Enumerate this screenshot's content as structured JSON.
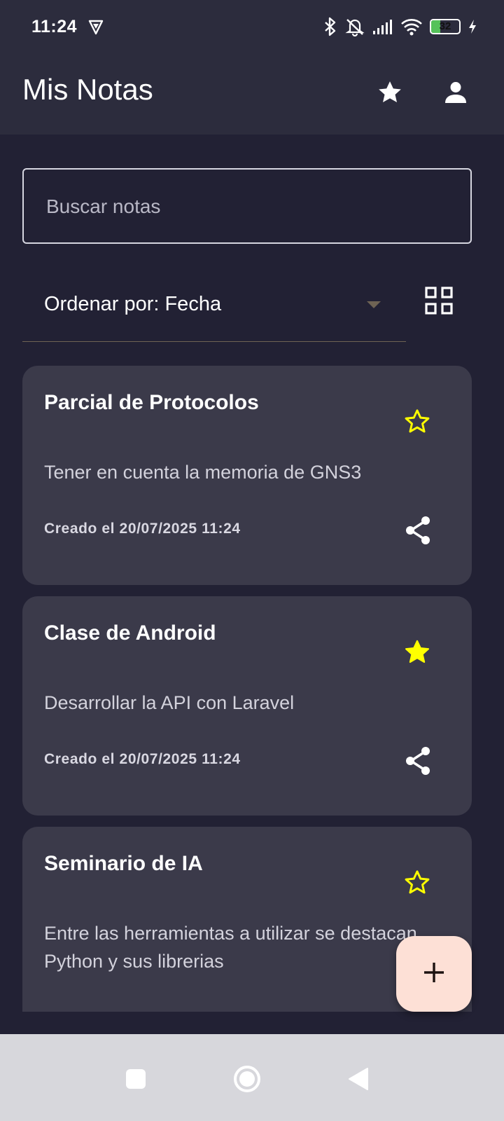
{
  "status_bar": {
    "time": "11:24",
    "battery_level": "32",
    "battery_fraction": 0.32,
    "icons": [
      "vpn-shield-icon",
      "bluetooth-icon",
      "muted-bell-icon",
      "signal-icon",
      "wifi-icon",
      "battery-icon",
      "charging-bolt-icon"
    ]
  },
  "app_bar": {
    "title": "Mis Notas",
    "icons": [
      "star-icon",
      "profile-icon"
    ]
  },
  "search": {
    "placeholder": "Buscar notas",
    "value": ""
  },
  "sort": {
    "label": "Ordenar por: Fecha",
    "icon": "dropdown-arrow-icon",
    "view_toggle_icon": "grid-view-icon"
  },
  "notes": [
    {
      "title": "Parcial de Protocolos",
      "body": "Tener en cuenta la memoria de GNS3",
      "date": "Creado el 20/07/2025 11:24",
      "favorite": false
    },
    {
      "title": "Clase de Android",
      "body": "Desarrollar la API con Laravel",
      "date": "Creado el 20/07/2025 11:24",
      "favorite": true
    },
    {
      "title": "Seminario de IA",
      "body": "Entre las herramientas a utilizar se destacan Python y sus librerias",
      "date": "",
      "favorite": false
    }
  ],
  "fab": {
    "icon": "add-icon"
  },
  "nav_bar": {
    "icons": [
      "recents-square-icon",
      "home-circle-icon",
      "back-triangle-icon"
    ]
  },
  "colors": {
    "background": "#222134",
    "app_bar": "#2c2c3d",
    "card": "#3b3a4a",
    "star": "#ffff00",
    "fab": "#fde0d6",
    "navbar": "#d7d7dc"
  }
}
